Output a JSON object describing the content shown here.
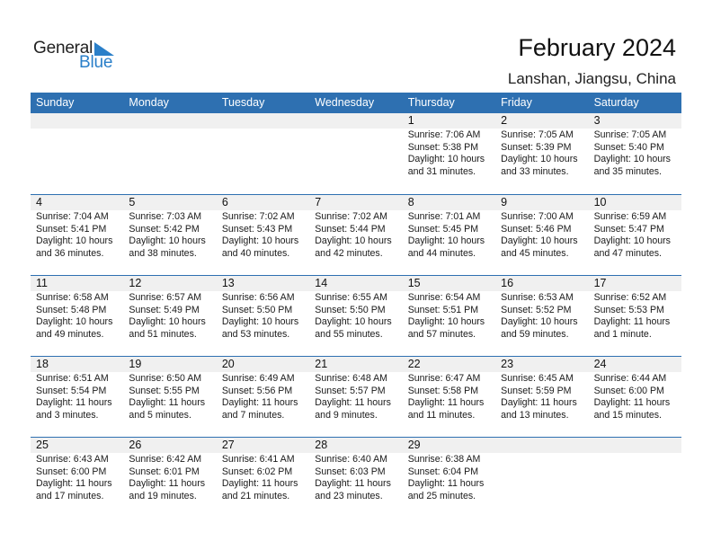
{
  "logo": {
    "line1": "General",
    "line2": "Blue",
    "icon": "triangle-flag-icon",
    "accent_color": "#2a7fc9"
  },
  "header": {
    "title": "February 2024",
    "location": "Lanshan, Jiangsu, China"
  },
  "colors": {
    "header_bg": "#2e70b1",
    "daynum_row_bg": "#f0f0f0"
  },
  "weekdays": [
    "Sunday",
    "Monday",
    "Tuesday",
    "Wednesday",
    "Thursday",
    "Friday",
    "Saturday"
  ],
  "weeks": [
    [
      null,
      null,
      null,
      null,
      {
        "day": "1",
        "sunrise": "Sunrise: 7:06 AM",
        "sunset": "Sunset: 5:38 PM",
        "daylight1": "Daylight: 10 hours",
        "daylight2": "and 31 minutes."
      },
      {
        "day": "2",
        "sunrise": "Sunrise: 7:05 AM",
        "sunset": "Sunset: 5:39 PM",
        "daylight1": "Daylight: 10 hours",
        "daylight2": "and 33 minutes."
      },
      {
        "day": "3",
        "sunrise": "Sunrise: 7:05 AM",
        "sunset": "Sunset: 5:40 PM",
        "daylight1": "Daylight: 10 hours",
        "daylight2": "and 35 minutes."
      }
    ],
    [
      {
        "day": "4",
        "sunrise": "Sunrise: 7:04 AM",
        "sunset": "Sunset: 5:41 PM",
        "daylight1": "Daylight: 10 hours",
        "daylight2": "and 36 minutes."
      },
      {
        "day": "5",
        "sunrise": "Sunrise: 7:03 AM",
        "sunset": "Sunset: 5:42 PM",
        "daylight1": "Daylight: 10 hours",
        "daylight2": "and 38 minutes."
      },
      {
        "day": "6",
        "sunrise": "Sunrise: 7:02 AM",
        "sunset": "Sunset: 5:43 PM",
        "daylight1": "Daylight: 10 hours",
        "daylight2": "and 40 minutes."
      },
      {
        "day": "7",
        "sunrise": "Sunrise: 7:02 AM",
        "sunset": "Sunset: 5:44 PM",
        "daylight1": "Daylight: 10 hours",
        "daylight2": "and 42 minutes."
      },
      {
        "day": "8",
        "sunrise": "Sunrise: 7:01 AM",
        "sunset": "Sunset: 5:45 PM",
        "daylight1": "Daylight: 10 hours",
        "daylight2": "and 44 minutes."
      },
      {
        "day": "9",
        "sunrise": "Sunrise: 7:00 AM",
        "sunset": "Sunset: 5:46 PM",
        "daylight1": "Daylight: 10 hours",
        "daylight2": "and 45 minutes."
      },
      {
        "day": "10",
        "sunrise": "Sunrise: 6:59 AM",
        "sunset": "Sunset: 5:47 PM",
        "daylight1": "Daylight: 10 hours",
        "daylight2": "and 47 minutes."
      }
    ],
    [
      {
        "day": "11",
        "sunrise": "Sunrise: 6:58 AM",
        "sunset": "Sunset: 5:48 PM",
        "daylight1": "Daylight: 10 hours",
        "daylight2": "and 49 minutes."
      },
      {
        "day": "12",
        "sunrise": "Sunrise: 6:57 AM",
        "sunset": "Sunset: 5:49 PM",
        "daylight1": "Daylight: 10 hours",
        "daylight2": "and 51 minutes."
      },
      {
        "day": "13",
        "sunrise": "Sunrise: 6:56 AM",
        "sunset": "Sunset: 5:50 PM",
        "daylight1": "Daylight: 10 hours",
        "daylight2": "and 53 minutes."
      },
      {
        "day": "14",
        "sunrise": "Sunrise: 6:55 AM",
        "sunset": "Sunset: 5:50 PM",
        "daylight1": "Daylight: 10 hours",
        "daylight2": "and 55 minutes."
      },
      {
        "day": "15",
        "sunrise": "Sunrise: 6:54 AM",
        "sunset": "Sunset: 5:51 PM",
        "daylight1": "Daylight: 10 hours",
        "daylight2": "and 57 minutes."
      },
      {
        "day": "16",
        "sunrise": "Sunrise: 6:53 AM",
        "sunset": "Sunset: 5:52 PM",
        "daylight1": "Daylight: 10 hours",
        "daylight2": "and 59 minutes."
      },
      {
        "day": "17",
        "sunrise": "Sunrise: 6:52 AM",
        "sunset": "Sunset: 5:53 PM",
        "daylight1": "Daylight: 11 hours",
        "daylight2": "and 1 minute."
      }
    ],
    [
      {
        "day": "18",
        "sunrise": "Sunrise: 6:51 AM",
        "sunset": "Sunset: 5:54 PM",
        "daylight1": "Daylight: 11 hours",
        "daylight2": "and 3 minutes."
      },
      {
        "day": "19",
        "sunrise": "Sunrise: 6:50 AM",
        "sunset": "Sunset: 5:55 PM",
        "daylight1": "Daylight: 11 hours",
        "daylight2": "and 5 minutes."
      },
      {
        "day": "20",
        "sunrise": "Sunrise: 6:49 AM",
        "sunset": "Sunset: 5:56 PM",
        "daylight1": "Daylight: 11 hours",
        "daylight2": "and 7 minutes."
      },
      {
        "day": "21",
        "sunrise": "Sunrise: 6:48 AM",
        "sunset": "Sunset: 5:57 PM",
        "daylight1": "Daylight: 11 hours",
        "daylight2": "and 9 minutes."
      },
      {
        "day": "22",
        "sunrise": "Sunrise: 6:47 AM",
        "sunset": "Sunset: 5:58 PM",
        "daylight1": "Daylight: 11 hours",
        "daylight2": "and 11 minutes."
      },
      {
        "day": "23",
        "sunrise": "Sunrise: 6:45 AM",
        "sunset": "Sunset: 5:59 PM",
        "daylight1": "Daylight: 11 hours",
        "daylight2": "and 13 minutes."
      },
      {
        "day": "24",
        "sunrise": "Sunrise: 6:44 AM",
        "sunset": "Sunset: 6:00 PM",
        "daylight1": "Daylight: 11 hours",
        "daylight2": "and 15 minutes."
      }
    ],
    [
      {
        "day": "25",
        "sunrise": "Sunrise: 6:43 AM",
        "sunset": "Sunset: 6:00 PM",
        "daylight1": "Daylight: 11 hours",
        "daylight2": "and 17 minutes."
      },
      {
        "day": "26",
        "sunrise": "Sunrise: 6:42 AM",
        "sunset": "Sunset: 6:01 PM",
        "daylight1": "Daylight: 11 hours",
        "daylight2": "and 19 minutes."
      },
      {
        "day": "27",
        "sunrise": "Sunrise: 6:41 AM",
        "sunset": "Sunset: 6:02 PM",
        "daylight1": "Daylight: 11 hours",
        "daylight2": "and 21 minutes."
      },
      {
        "day": "28",
        "sunrise": "Sunrise: 6:40 AM",
        "sunset": "Sunset: 6:03 PM",
        "daylight1": "Daylight: 11 hours",
        "daylight2": "and 23 minutes."
      },
      {
        "day": "29",
        "sunrise": "Sunrise: 6:38 AM",
        "sunset": "Sunset: 6:04 PM",
        "daylight1": "Daylight: 11 hours",
        "daylight2": "and 25 minutes."
      },
      null,
      null
    ]
  ]
}
